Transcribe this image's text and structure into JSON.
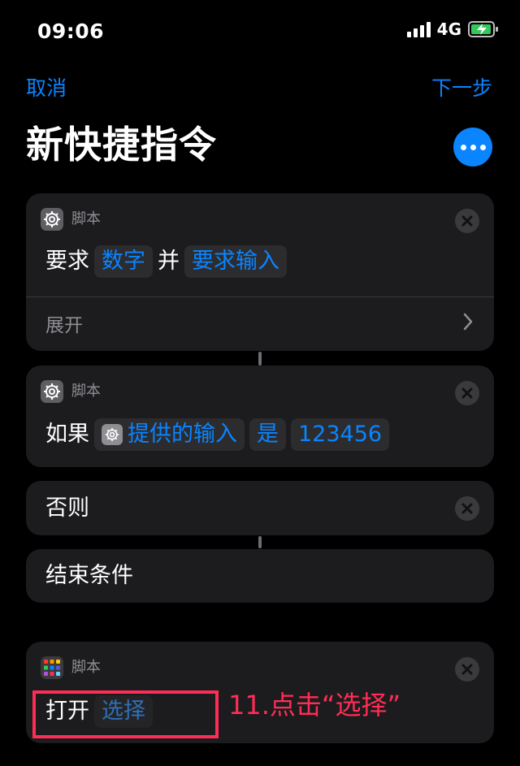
{
  "status_bar": {
    "time": "09:06",
    "network": "4G"
  },
  "nav": {
    "cancel": "取消",
    "next": "下一步"
  },
  "title": "新快捷指令",
  "cards": {
    "ask": {
      "category": "脚本",
      "verb": "要求",
      "type_token": "数字",
      "conjunction": "并",
      "prompt_token": "要求输入",
      "expand_label": "展开"
    },
    "if": {
      "category": "脚本",
      "verb": "如果",
      "input_token": "提供的输入",
      "condition_token": "是",
      "value_token": "123456"
    },
    "otherwise": {
      "label": "否则"
    },
    "end_if": {
      "label": "结束条件"
    },
    "open": {
      "category": "脚本",
      "verb": "打开",
      "choose_token": "选择"
    }
  },
  "annotation": {
    "text": "11.点击“选择”",
    "color": "#ff2d55"
  },
  "colors": {
    "accent": "#0a84ff",
    "card_background": "#1c1c1e",
    "background": "#000000"
  },
  "icons": {
    "script": "gear-icon",
    "apps": "app-grid-icon",
    "close": "close-icon",
    "more": "ellipsis-icon",
    "expand": "chevron-right-icon"
  }
}
